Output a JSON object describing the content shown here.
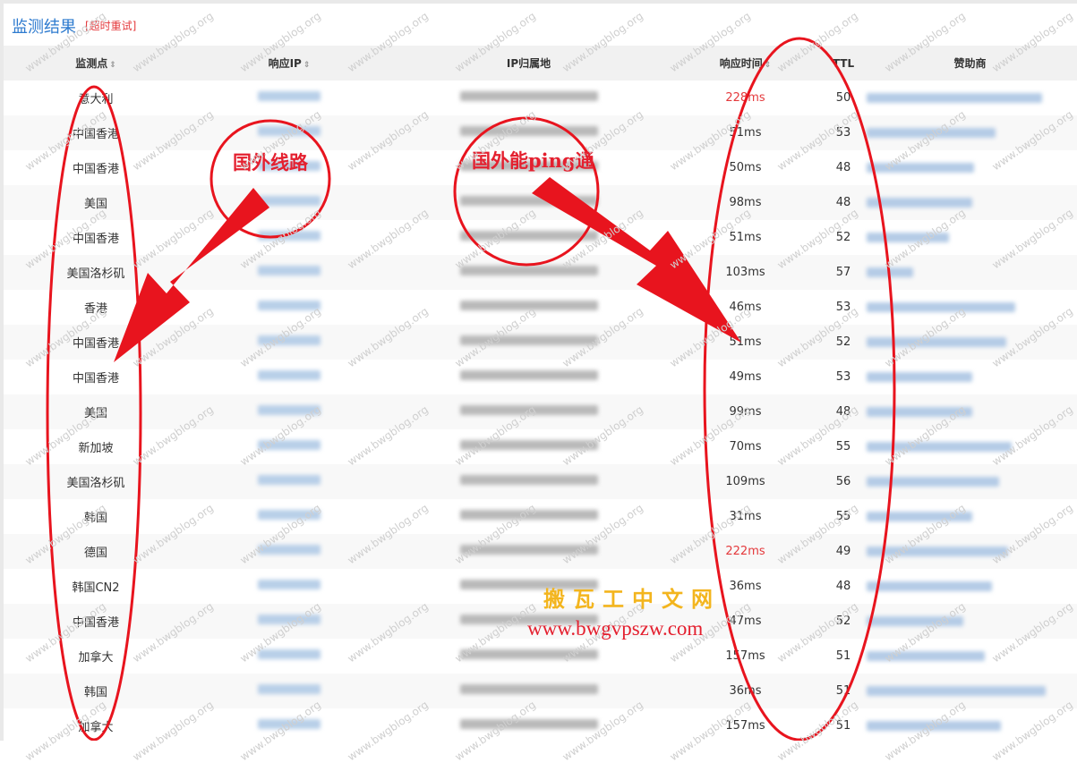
{
  "header": {
    "title": "监测结果",
    "retry": "[超时重试]"
  },
  "columns": {
    "node": "监测点",
    "ip": "响应IP",
    "location": "IP归属地",
    "time": "响应时间",
    "ttl": "TTL",
    "sponsor": "赞助商",
    "sort_icon": "sort-arrows-icon"
  },
  "rows": [
    {
      "node": "意大利",
      "time": "228ms",
      "ttl": "50",
      "slow": true
    },
    {
      "node": "中国香港",
      "time": "51ms",
      "ttl": "53"
    },
    {
      "node": "中国香港",
      "time": "50ms",
      "ttl": "48"
    },
    {
      "node": "美国",
      "time": "98ms",
      "ttl": "48"
    },
    {
      "node": "中国香港",
      "time": "51ms",
      "ttl": "52"
    },
    {
      "node": "美国洛杉矶",
      "time": "103ms",
      "ttl": "57"
    },
    {
      "node": "香港",
      "time": "46ms",
      "ttl": "53"
    },
    {
      "node": "中国香港",
      "time": "51ms",
      "ttl": "52"
    },
    {
      "node": "中国香港",
      "time": "49ms",
      "ttl": "53"
    },
    {
      "node": "美国",
      "time": "99ms",
      "ttl": "48"
    },
    {
      "node": "新加坡",
      "time": "70ms",
      "ttl": "55"
    },
    {
      "node": "美国洛杉矶",
      "time": "109ms",
      "ttl": "56"
    },
    {
      "node": "韩国",
      "time": "31ms",
      "ttl": "55"
    },
    {
      "node": "德国",
      "time": "222ms",
      "ttl": "49",
      "slow": true
    },
    {
      "node": "韩国CN2",
      "time": "36ms",
      "ttl": "48"
    },
    {
      "node": "中国香港",
      "time": "47ms",
      "ttl": "52"
    },
    {
      "node": "加拿大",
      "time": "157ms",
      "ttl": "51"
    },
    {
      "node": "韩国",
      "time": "36ms",
      "ttl": "51"
    },
    {
      "node": "加拿大",
      "time": "157ms",
      "ttl": "51"
    }
  ],
  "annotations": {
    "left": "国外线路",
    "right": "国外能ping通"
  },
  "watermark": "www.bwgblog.org",
  "brand": {
    "name": "搬瓦工中文网",
    "url": "www.bwgvpszw.com"
  },
  "colors": {
    "title": "#2e7bcf",
    "alert": "#e4393c",
    "annotation": "#e4202f",
    "brand": "#f3b51e"
  }
}
